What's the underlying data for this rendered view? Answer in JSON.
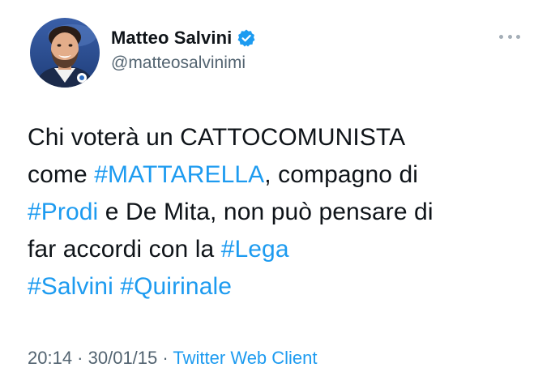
{
  "author": {
    "display_name": "Matteo Salvini",
    "handle": "@matteosalvinimi",
    "verified": true
  },
  "more_icon": "more-horizontal-icon",
  "tweet": {
    "lines": [
      [
        {
          "t": "Chi voterà un CATTOCOMUNISTA",
          "hashtag": false
        }
      ],
      [
        {
          "t": "come ",
          "hashtag": false
        },
        {
          "t": "#MATTARELLA",
          "hashtag": true
        },
        {
          "t": ", compagno di",
          "hashtag": false
        }
      ],
      [
        {
          "t": "#Prodi",
          "hashtag": true
        },
        {
          "t": " e De Mita, non può pensare di",
          "hashtag": false
        }
      ],
      [
        {
          "t": "far accordi con la ",
          "hashtag": false
        },
        {
          "t": "#Lega",
          "hashtag": true
        }
      ],
      [
        {
          "t": "#Salvini",
          "hashtag": true
        },
        {
          "t": " ",
          "hashtag": false
        },
        {
          "t": "#Quirinale",
          "hashtag": true
        }
      ]
    ]
  },
  "meta": {
    "time": "20:14",
    "separator1": " · ",
    "date": "30/01/15",
    "separator2": " · ",
    "source": "Twitter Web Client"
  },
  "colors": {
    "text": "#0f1419",
    "secondary": "#536471",
    "link": "#1d9bf0",
    "verified": "#1d9bf0"
  }
}
